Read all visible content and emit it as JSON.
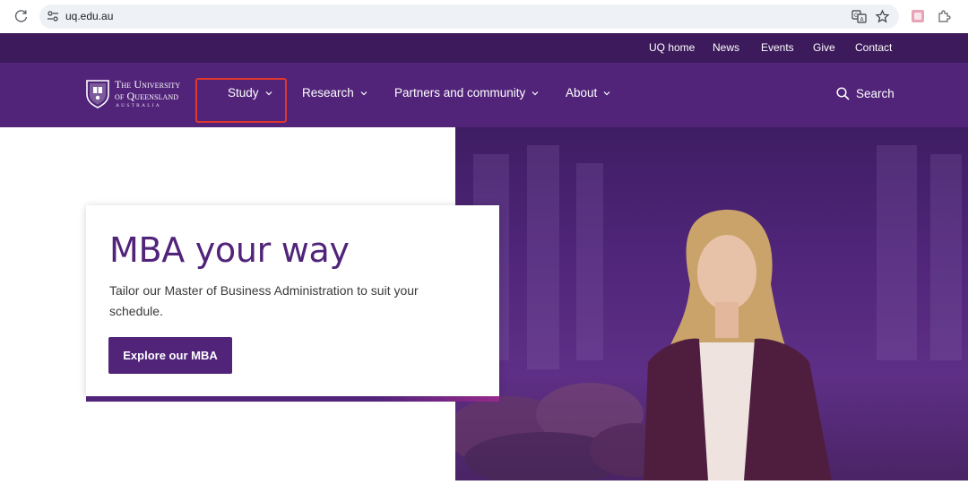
{
  "browser": {
    "url": "uq.edu.au",
    "icons": [
      "reload-icon",
      "site-info-icon",
      "translate-icon",
      "bookmark-star-icon",
      "extension-icon",
      "extensions-puzzle-icon"
    ]
  },
  "utility_nav": {
    "items": [
      "UQ home",
      "News",
      "Events",
      "Give",
      "Contact"
    ]
  },
  "logo": {
    "line1": "The University",
    "line2": "of Queensland",
    "line3": "AUSTRALIA"
  },
  "main_nav": {
    "items": [
      "Study",
      "Research",
      "Partners and community",
      "About"
    ],
    "search_label": "Search"
  },
  "hero": {
    "title": "MBA your way",
    "description": "Tailor our Master of Business Administration to suit your schedule.",
    "cta_label": "Explore our MBA"
  },
  "colors": {
    "brand_purple": "#51247a",
    "utility_purple": "#3c1a5b",
    "highlight_red": "#e0372b"
  }
}
